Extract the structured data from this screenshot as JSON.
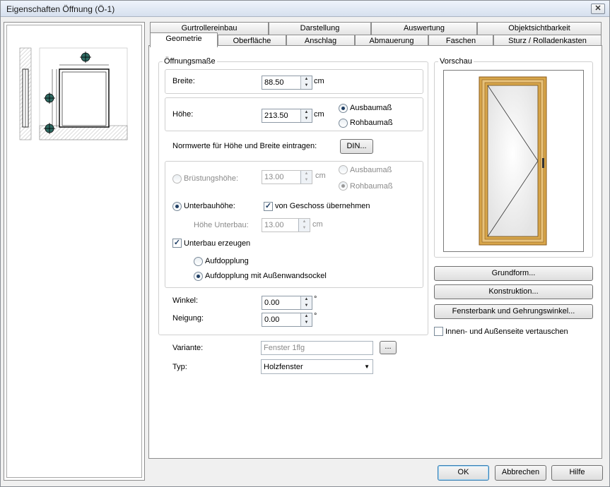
{
  "window": {
    "title": "Eigenschaften Öffnung (Ö-1)",
    "close_glyph": "✕"
  },
  "tabs_row1": [
    "Gurtrollereinbau",
    "Darstellung",
    "Auswertung",
    "Objektsichtbarkeit"
  ],
  "tabs_row2": [
    "Geometrie",
    "Oberfläche",
    "Anschlag",
    "Abmauerung",
    "Faschen",
    "Sturz / Rolladenkasten"
  ],
  "oeffnung": {
    "group_title": "Öffnungsmaße",
    "breite_label": "Breite:",
    "breite_value": "88.50",
    "breite_unit": "cm",
    "hoehe_label": "Höhe:",
    "hoehe_value": "213.50",
    "hoehe_unit": "cm",
    "ausbaumass": "Ausbaumaß",
    "rohbaumass": "Rohbaumaß",
    "norm_label": "Normwerte für Höhe und Breite eintragen:",
    "din_button": "DIN...",
    "bruestung_label": "Brüstungshöhe:",
    "bruestung_value": "13.00",
    "bruestung_unit": "cm",
    "b_ausbaumass": "Ausbaumaß",
    "b_rohbaumass": "Rohbaumaß",
    "unterbau_label": "Unterbauhöhe:",
    "geschoss_label": "von Geschoss übernehmen",
    "hoehe_unterbau_label": "Höhe Unterbau:",
    "hoehe_unterbau_value": "13.00",
    "hoehe_unterbau_unit": "cm",
    "unterbau_erzeugen": "Unterbau erzeugen",
    "aufdopplung": "Aufdopplung",
    "aufdopplung_sockel": "Aufdopplung mit Außenwandsockel",
    "winkel_label": "Winkel:",
    "winkel_value": "0.00",
    "winkel_unit": "°",
    "neigung_label": "Neigung:",
    "neigung_value": "0.00",
    "neigung_unit": "°",
    "checkmark": "✓"
  },
  "variante": {
    "label": "Variante:",
    "value": "Fenster 1flg",
    "browse": "..."
  },
  "typ": {
    "label": "Typ:",
    "value": "Holzfenster",
    "arrow": "▼"
  },
  "vorschau": {
    "title": "Vorschau"
  },
  "side_buttons": {
    "grundform": "Grundform...",
    "konstruktion": "Konstruktion...",
    "fensterbank": "Fensterbank und Gehrungswinkel...",
    "vertauschen": "Innen- und Außenseite vertauschen"
  },
  "spin_up": "▲",
  "spin_down": "▼",
  "footer": {
    "ok": "OK",
    "abbrechen": "Abbrechen",
    "hilfe": "Hilfe"
  },
  "colors": {
    "frame_wood": "#d8a64a",
    "frame_dark": "#8a5a1a",
    "marker": "#2f6b63"
  }
}
